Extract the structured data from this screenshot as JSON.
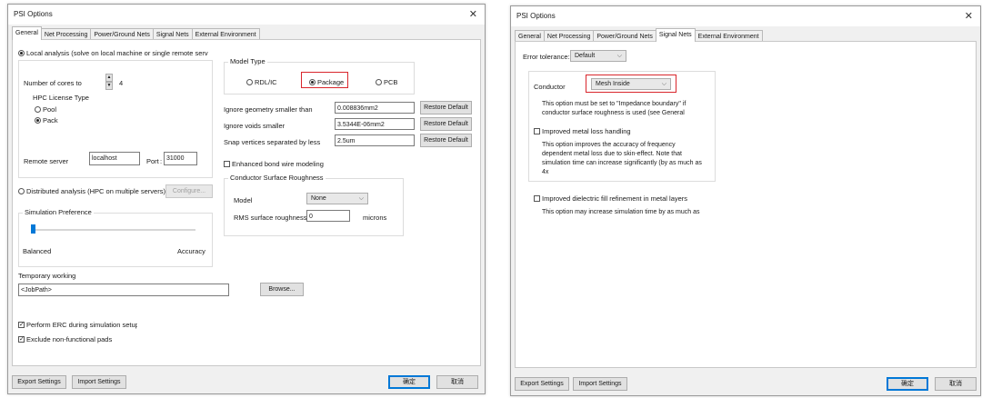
{
  "left": {
    "title": "PSI Options",
    "tabs": [
      "General",
      "Net Processing",
      "Power/Ground Nets",
      "Signal Nets",
      "External Environment"
    ],
    "local_analysis_label": "Local analysis (solve on local machine or single remote server",
    "cores_label": "Number of cores to",
    "cores_value": "4",
    "hpc_label": "HPC License Type",
    "pool_label": "Pool",
    "pack_label": "Pack",
    "remote_server_label": "Remote server",
    "remote_server_value": "localhost",
    "port_label": "Port",
    "port_value": "31000",
    "distributed_label": "Distributed analysis (HPC on multiple servers)",
    "configure_label": "Configure...",
    "sim_pref_label": "Simulation Preference",
    "balanced_label": "Balanced",
    "accuracy_label": "Accuracy",
    "slider_level": 0.0,
    "model_type_label": "Model Type",
    "rdl_label": "RDL/IC",
    "package_label": "Package",
    "pcb_label": "PCB",
    "ignore_geometry_label": "Ignore geometry smaller than",
    "ignore_geometry_value": "0.008836mm2",
    "ignore_voids_label": "Ignore voids smaller",
    "ignore_voids_value": "3.5344E-06mm2",
    "snap_label": "Snap vertices separated by less",
    "snap_value": "2.5um",
    "restore_default_label": "Restore Default",
    "bond_wire_label": "Enhanced bond wire modeling",
    "roughness_label": "Conductor Surface Roughness",
    "model_label": "Model",
    "model_value": "None",
    "rms_label": "RMS surface roughness:",
    "rms_value": "0",
    "microns_label": "microns",
    "temp_label": "Temporary working",
    "temp_value": "<JobPath>",
    "browse_label": "Browse...",
    "erc_label": "Perform ERC during simulation setup",
    "exclude_label": "Exclude non-functional pads",
    "export_label": "Export Settings",
    "import_label": "Import Settings",
    "ok_label": "确定",
    "cancel_label": "取消",
    "close_glyph": "✕"
  },
  "right": {
    "title": "PSI Options",
    "tabs": [
      "General",
      "Net Processing",
      "Power/Ground Nets",
      "Signal Nets",
      "External Environment"
    ],
    "error_tol_label": "Error tolerance:",
    "error_tol_value": "Default",
    "conductor_label": "Conductor",
    "conductor_value": "Mesh Inside",
    "conductor_note_1": "This option must be set to \"Impedance boundary\" if",
    "conductor_note_2": "conductor surface roughness is used (see General",
    "metal_loss_label": "Improved metal loss handling",
    "metal_loss_note_1": "This option improves the accuracy of frequency",
    "metal_loss_note_2": "dependent metal loss due to skin-effect. Note that",
    "metal_loss_note_3": "simulation time can increase significantly (by as much as",
    "metal_loss_note_4": "4x",
    "dielectric_label": "Improved dielectric fill refinement in metal layers",
    "dielectric_note": "This option may increase simulation time by as much as",
    "export_label": "Export Settings",
    "import_label": "Import Settings",
    "ok_label": "确定",
    "cancel_label": "取消",
    "close_glyph": "✕"
  },
  "colors": {
    "highlight": "#d9262c",
    "primary_border": "#0078d7",
    "dialog_bg": "#f0f0f0"
  },
  "icons": [
    "close-icon",
    "chevron-down-icon",
    "spinner-up-icon",
    "spinner-down-icon",
    "check-icon"
  ]
}
